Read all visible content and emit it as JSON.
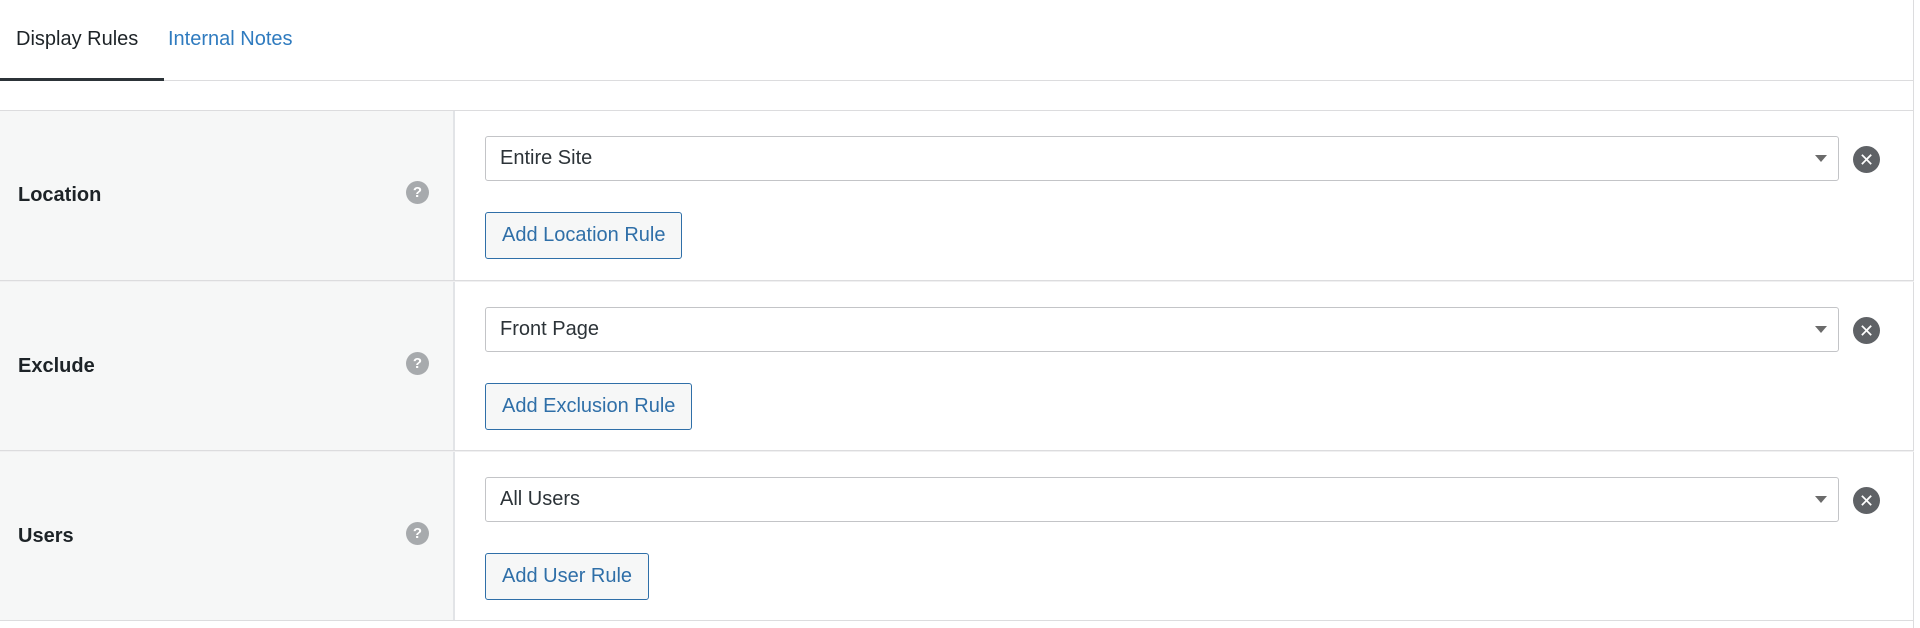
{
  "tabs": [
    {
      "label": "Display Rules",
      "active": true
    },
    {
      "label": "Internal Notes",
      "active": false
    }
  ],
  "rows": [
    {
      "label": "Location",
      "help_icon": "question-mark-icon",
      "select_value": "Entire Site",
      "add_button_label": "Add Location Rule"
    },
    {
      "label": "Exclude",
      "help_icon": "question-mark-icon",
      "select_value": "Front Page",
      "add_button_label": "Add Exclusion Rule"
    },
    {
      "label": "Users",
      "help_icon": "question-mark-icon",
      "select_value": "All Users",
      "add_button_label": "Add User Rule"
    }
  ],
  "colors": {
    "accent": "#2f6fa8",
    "tab_link": "#2f7bbf",
    "label_bg": "#f6f7f7",
    "border": "#dcdcde",
    "help_icon": "#a7aaad",
    "remove_icon": "#5f6266"
  },
  "glyphs": {
    "help": "?",
    "remove": "✕"
  }
}
